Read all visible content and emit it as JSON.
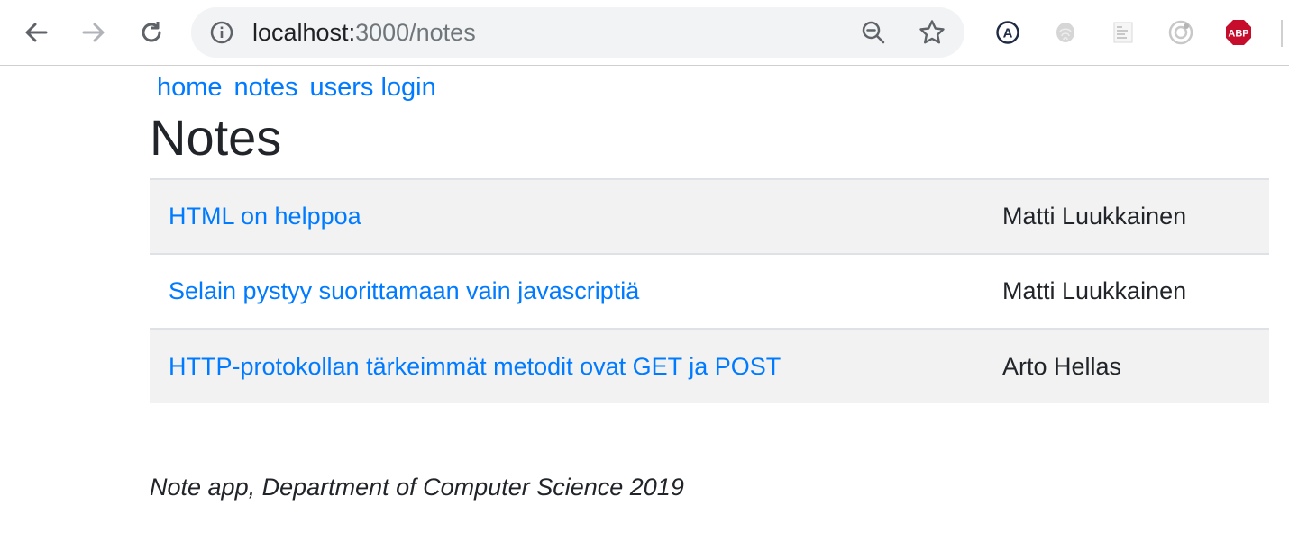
{
  "browser": {
    "url_host": "localhost:",
    "url_path": "3000/notes",
    "extension_abp_label": "ABP",
    "extension_a_label": "A"
  },
  "nav": {
    "home": "home",
    "notes": "notes",
    "login": "users login"
  },
  "page_title": "Notes",
  "notes": [
    {
      "content": "HTML on helppoa",
      "user": "Matti Luukkainen"
    },
    {
      "content": "Selain pystyy suorittamaan vain javascriptiä",
      "user": "Matti Luukkainen"
    },
    {
      "content": "HTTP-protokollan tärkeimmät metodit ovat GET ja POST",
      "user": "Arto Hellas"
    }
  ],
  "footer": "Note app, Department of Computer Science 2019",
  "colors": {
    "link": "#007bff",
    "text": "#212529",
    "stripe": "#f2f2f2",
    "abp_red": "#c70d2c"
  }
}
